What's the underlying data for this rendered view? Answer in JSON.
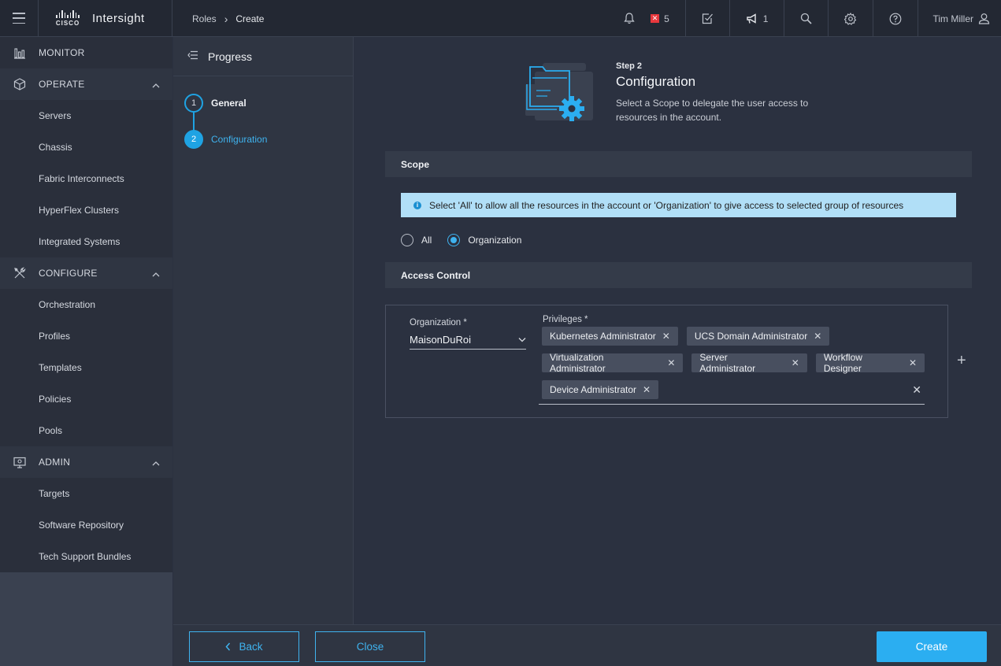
{
  "app": {
    "brand_logo_text": "CISCO",
    "brand_name": "Intersight"
  },
  "breadcrumb": {
    "parent": "Roles",
    "current": "Create"
  },
  "topbar": {
    "alerts_count": "5",
    "announcements_count": "1",
    "user_name": "Tim Miller"
  },
  "nav": {
    "monitor": "MONITOR",
    "operate": "OPERATE",
    "operate_items": [
      "Servers",
      "Chassis",
      "Fabric Interconnects",
      "HyperFlex Clusters",
      "Integrated Systems"
    ],
    "configure": "CONFIGURE",
    "configure_items": [
      "Orchestration",
      "Profiles",
      "Templates",
      "Policies",
      "Pools"
    ],
    "admin": "ADMIN",
    "admin_items": [
      "Targets",
      "Software Repository",
      "Tech Support Bundles"
    ]
  },
  "progress": {
    "title": "Progress",
    "steps": [
      {
        "number": "1",
        "label": "General"
      },
      {
        "number": "2",
        "label": "Configuration"
      }
    ]
  },
  "step": {
    "small": "Step 2",
    "title": "Configuration",
    "description": "Select a Scope to delegate the user access to resources in the account."
  },
  "scope": {
    "title": "Scope",
    "info": "Select 'All' to allow all the resources in the account or 'Organization' to give access to selected group of resources",
    "options": [
      "All",
      "Organization"
    ],
    "selected": "Organization"
  },
  "access_control": {
    "title": "Access Control",
    "organization_label": "Organization *",
    "organization_value": "MaisonDuRoi",
    "privileges_label": "Privileges *",
    "privileges": [
      "Kubernetes Administrator",
      "UCS Domain Administrator",
      "Virtualization Administrator",
      "Server Administrator",
      "Workflow Designer",
      "Device Administrator"
    ]
  },
  "footer": {
    "back": "Back",
    "close": "Close",
    "create": "Create"
  },
  "colors": {
    "accent": "#2baef1",
    "background": "#2b3140",
    "info_banner": "#b1dff7",
    "alert": "#e8383d"
  }
}
